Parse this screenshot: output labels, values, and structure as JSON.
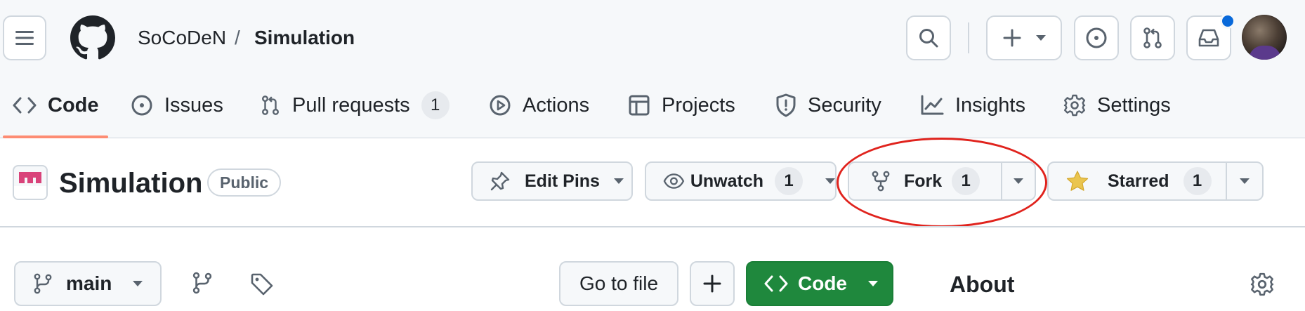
{
  "header": {
    "owner": "SoCoDeN",
    "separator": "/",
    "repo": "Simulation"
  },
  "nav": {
    "tabs": [
      {
        "label": "Code",
        "icon": "code-icon",
        "selected": true
      },
      {
        "label": "Issues",
        "icon": "issue-opened-icon"
      },
      {
        "label": "Pull requests",
        "icon": "git-pull-request-icon",
        "count": "1"
      },
      {
        "label": "Actions",
        "icon": "play-icon"
      },
      {
        "label": "Projects",
        "icon": "table-icon"
      },
      {
        "label": "Security",
        "icon": "shield-icon"
      },
      {
        "label": "Insights",
        "icon": "graph-icon"
      },
      {
        "label": "Settings",
        "icon": "gear-icon"
      }
    ]
  },
  "repo_header": {
    "title": "Simulation",
    "visibility": "Public",
    "edit_pins": "Edit Pins",
    "unwatch": "Unwatch",
    "unwatch_count": "1",
    "fork": "Fork",
    "fork_count": "1",
    "starred": "Starred",
    "starred_count": "1"
  },
  "toolbar": {
    "branch": "main",
    "go_to_file": "Go to file",
    "add": "+",
    "code": "Code"
  },
  "sidebar": {
    "about": "About"
  },
  "colors": {
    "accent_underline": "#fd8c73",
    "code_button": "#1f883d",
    "star": "#eac54f",
    "notification_dot": "#0969da",
    "annotation": "#e0231d"
  }
}
